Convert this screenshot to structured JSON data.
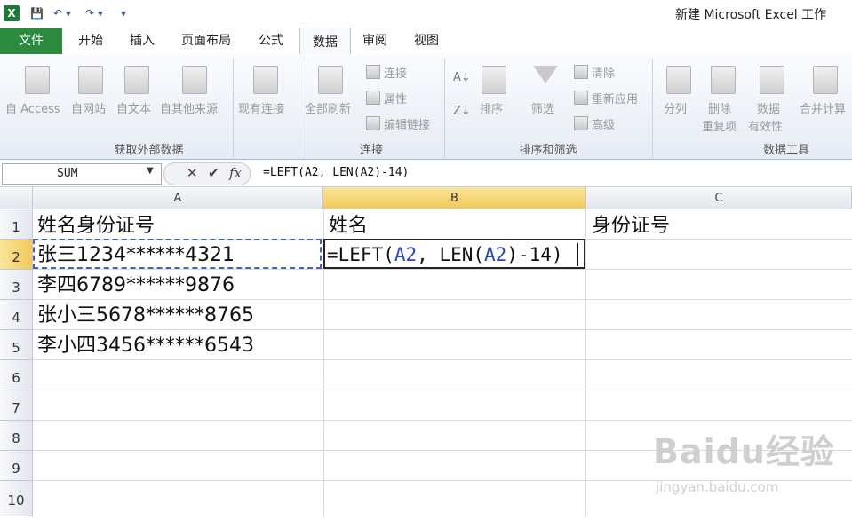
{
  "window": {
    "title": "新建 Microsoft Excel 工作"
  },
  "tabs": [
    {
      "label": "文件"
    },
    {
      "label": "开始"
    },
    {
      "label": "插入"
    },
    {
      "label": "页面布局"
    },
    {
      "label": "公式"
    },
    {
      "label": "数据"
    },
    {
      "label": "审阅"
    },
    {
      "label": "视图"
    }
  ],
  "ribbon": {
    "get_external": {
      "items": [
        "自 Access",
        "自网站",
        "自文本",
        "自其他来源"
      ],
      "existing": "现有连接",
      "label": "获取外部数据"
    },
    "connections": {
      "refresh_all": "全部刷新",
      "connections": "连接",
      "properties": "属性",
      "edit_links": "编辑链接",
      "label": "连接"
    },
    "sort_filter": {
      "sort": "排序",
      "filter": "筛选",
      "clear": "清除",
      "reapply": "重新应用",
      "advanced": "高级",
      "label": "排序和筛选"
    },
    "data_tools": {
      "split": "分列",
      "remove_dup_1": "删除",
      "remove_dup_2": "重复项",
      "validation_1": "数据",
      "validation_2": "有效性",
      "consolidate": "合并计算",
      "label": "数据工具"
    }
  },
  "formula_bar": {
    "name_box": "SUM",
    "formula": "=LEFT(A2, LEN(A2)-14)"
  },
  "columns": [
    "A",
    "B",
    "C"
  ],
  "rows": [
    "1",
    "2",
    "3",
    "4",
    "5",
    "6",
    "7",
    "8",
    "9",
    "10"
  ],
  "cells": {
    "A1": "姓名身份证号",
    "B1": "姓名",
    "C1": "身份证号",
    "A2": "张三1234******4321",
    "A3": "李四6789******9876",
    "A4": "张小三5678******8765",
    "A5": "李小四3456******6543"
  },
  "edit": {
    "prefix": "=LEFT(",
    "ref1": "A2",
    "mid": ", LEN(",
    "ref2": "A2",
    "suffix": ")-14)"
  },
  "watermark": {
    "main": "Baidu经验",
    "sub": "jingyan.baidu.com"
  }
}
